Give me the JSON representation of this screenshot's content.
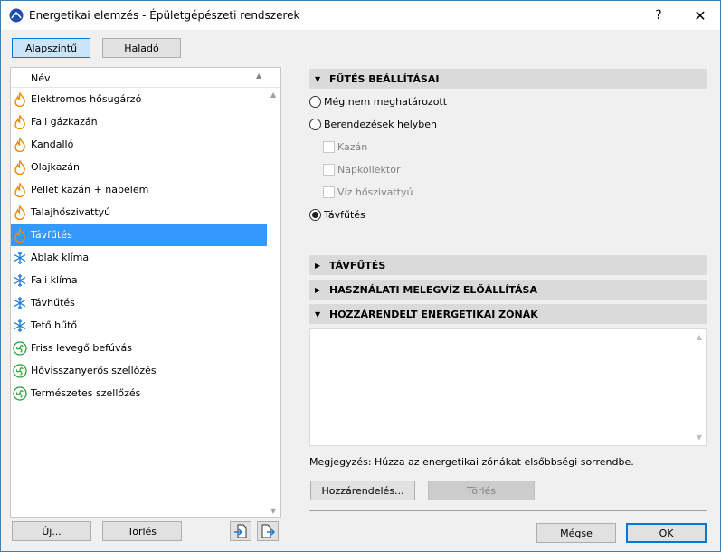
{
  "window": {
    "title": "Energetikai elemzés - Épületgépészeti rendszerek",
    "help_label": "?",
    "close_label": "✕"
  },
  "mode_tabs": {
    "basic": "Alapszintű",
    "advanced": "Haladó"
  },
  "list": {
    "header": "Név",
    "items": [
      {
        "label": "Elektromos hősugárzó",
        "icon": "flame-icon"
      },
      {
        "label": "Fali gázkazán",
        "icon": "flame-icon"
      },
      {
        "label": "Kandalló",
        "icon": "flame-icon"
      },
      {
        "label": "Olajkazán",
        "icon": "flame-icon"
      },
      {
        "label": "Pellet kazán + napelem",
        "icon": "flame-icon"
      },
      {
        "label": "Talajhőszivattyú",
        "icon": "flame-icon"
      },
      {
        "label": "Távfűtés",
        "icon": "flame-icon",
        "selected": true
      },
      {
        "label": "Ablak klíma",
        "icon": "snowflake-icon"
      },
      {
        "label": "Fali klíma",
        "icon": "snowflake-icon"
      },
      {
        "label": "Távhűtés",
        "icon": "snowflake-icon"
      },
      {
        "label": "Tető hűtő",
        "icon": "snowflake-icon"
      },
      {
        "label": "Friss levegő befúvás",
        "icon": "fan-icon"
      },
      {
        "label": "Hővisszanyerős szellőzés",
        "icon": "fan-icon"
      },
      {
        "label": "Természetes szellőzés",
        "icon": "fan-icon"
      }
    ]
  },
  "left_buttons": {
    "new": "Új...",
    "delete": "Törlés"
  },
  "heating_settings": {
    "header": "FŰTÉS BEÁLLÍTÁSAI",
    "option_undefined": "Még nem meghatározott",
    "option_onsite": "Berendezések helyben",
    "sub_boiler": "Kazán",
    "sub_solar": "Napkollektor",
    "sub_heatpump": "Víz hőszivattyú",
    "option_district": "Távfűtés",
    "selected": "Távfűtés"
  },
  "sections": {
    "district_heating": "TÁVFŰTÉS",
    "hot_water": "HASZNÁLATI MELEGVÍZ ELŐÁLLÍTÁSA",
    "zones": "HOZZÁRENDELT ENERGETIKAI ZÓNÁK"
  },
  "zones_note": "Megjegyzés: Húzza az energetikai zónákat elsőbbségi sorrendbe.",
  "zone_buttons": {
    "assign": "Hozzárendelés...",
    "delete": "Törlés"
  },
  "dialog_buttons": {
    "cancel": "Mégse",
    "ok": "OK"
  },
  "colors": {
    "selection": "#3399ff",
    "flame": "#f08a00",
    "snowflake": "#1e78d2",
    "fan": "#2aa03a",
    "accent": "#0078d7"
  }
}
